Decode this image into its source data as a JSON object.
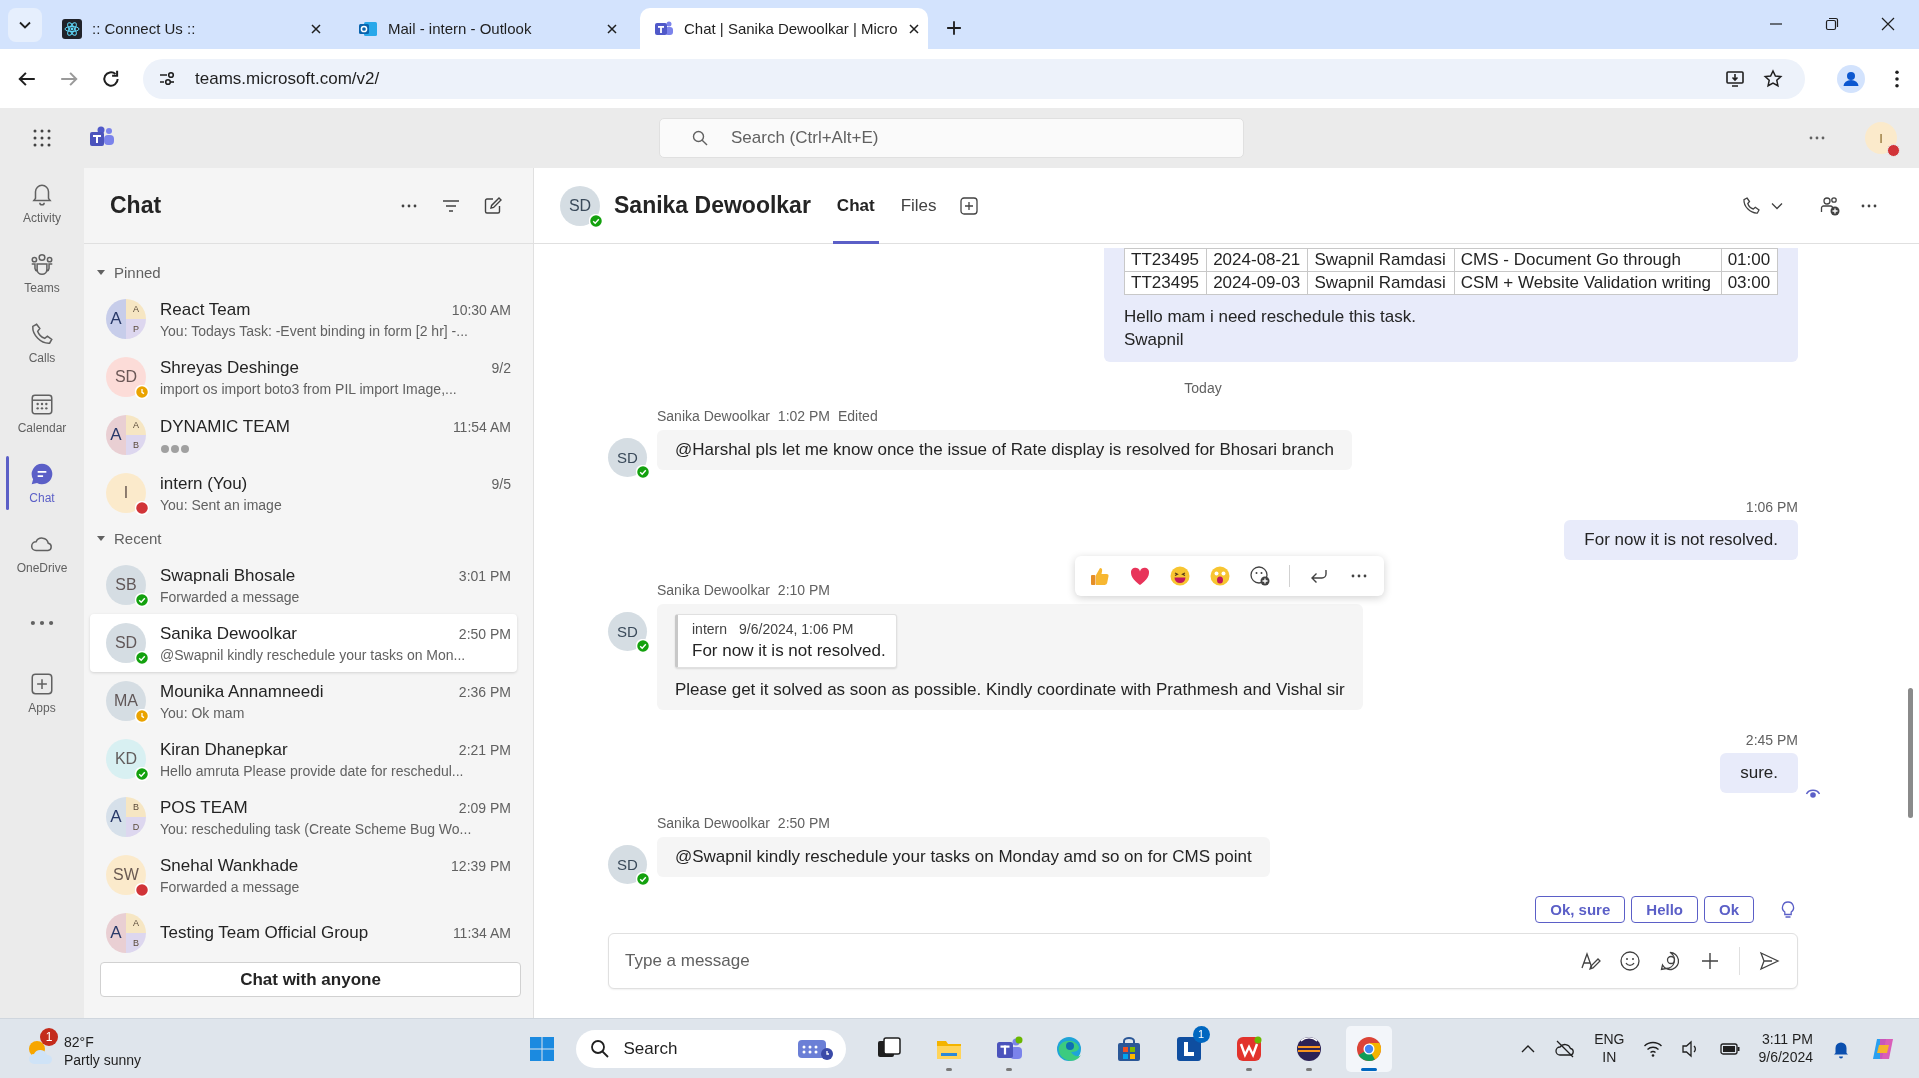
{
  "browser": {
    "tabs": [
      {
        "title": ":: Connect Us ::",
        "kind": "atom",
        "selected": false
      },
      {
        "title": "Mail - intern - Outlook",
        "kind": "mail",
        "selected": false
      },
      {
        "title": "Chat | Sanika Dewoolkar | Micro",
        "kind": "teams",
        "selected": true
      }
    ],
    "url": "teams.microsoft.com/v2/"
  },
  "teams_bar": {
    "search_placeholder": "Search (Ctrl+Alt+E)",
    "avatar": "I"
  },
  "rail": [
    {
      "label": "Activity",
      "kind": "bell",
      "selected": false
    },
    {
      "label": "Teams",
      "kind": "people",
      "selected": false
    },
    {
      "label": "Calls",
      "kind": "phone",
      "selected": false
    },
    {
      "label": "Calendar",
      "kind": "calendar",
      "selected": false
    },
    {
      "label": "Chat",
      "kind": "chat",
      "selected": true
    },
    {
      "label": "OneDrive",
      "kind": "cloud",
      "selected": false
    },
    {
      "kind": "more",
      "selected": false
    },
    {
      "label": "Apps",
      "kind": "apps",
      "selected": false
    }
  ],
  "chat_list": {
    "title": "Chat",
    "sections": [
      {
        "label": "Pinned",
        "expanded": true,
        "items": [
          {
            "name": "React Team",
            "time": "10:30 AM",
            "preview": "You: Todays Task: -Event binding in form [2 hr] -...",
            "group": [
              "A",
              "A",
              "P"
            ],
            "color": "#c7cdea",
            "selected": false
          },
          {
            "name": "Shreyas Deshinge",
            "time": "9/2",
            "preview": "import os import boto3 from PIL import Image,...",
            "initials": "SD",
            "color": "#fcdcd8",
            "presence": {
              "kind": "away",
              "color": "#eaa300"
            },
            "selected": false
          },
          {
            "name": "DYNAMIC TEAM",
            "time": "11:54 AM",
            "typing": true,
            "group": [
              "A",
              "A",
              "B"
            ],
            "color": "#e9cfd3",
            "selected": false
          },
          {
            "name": "intern (You)",
            "time": "9/5",
            "preview": "You: Sent an image",
            "initials": "I",
            "color": "#fbeacb",
            "presence": {
              "kind": "busy",
              "color": "#d13438"
            },
            "selected": false
          }
        ]
      },
      {
        "label": "Recent",
        "expanded": true,
        "items": [
          {
            "name": "Swapnali Bhosale",
            "time": "3:01 PM",
            "preview": "Forwarded a message",
            "initials": "SB",
            "color": "#d5dde3",
            "presence": {
              "kind": "available",
              "color": "#13a10e"
            },
            "selected": false
          },
          {
            "name": "Sanika Dewoolkar",
            "time": "2:50 PM",
            "preview": "@Swapnil kindly reschedule your tasks on Mon...",
            "initials": "SD",
            "color": "#d5dde3",
            "presence": {
              "kind": "available",
              "color": "#13a10e"
            },
            "selected": true
          },
          {
            "name": "Mounika Annamneedi",
            "time": "2:36 PM",
            "preview": "You: Ok mam",
            "initials": "MA",
            "color": "#d5dde3",
            "presence": {
              "kind": "away",
              "color": "#eaa300"
            },
            "selected": false
          },
          {
            "name": "Kiran Dhanepkar",
            "time": "2:21 PM",
            "preview": "Hello amruta Please provide date for reschedul...",
            "initials": "KD",
            "color": "#d8f0f2",
            "presence": {
              "kind": "available",
              "color": "#13a10e"
            },
            "selected": false
          },
          {
            "name": "POS TEAM",
            "time": "2:09 PM",
            "preview": "You: rescheduling task (Create Scheme Bug Wo...",
            "group": [
              "A",
              "B",
              "D"
            ],
            "color": "#d6e0ea",
            "selected": false
          },
          {
            "name": "Snehal Wankhade",
            "time": "12:39 PM",
            "preview": "Forwarded a message",
            "initials": "SW",
            "color": "#fbeacb",
            "presence": {
              "kind": "busy",
              "color": "#d13438"
            },
            "selected": false
          },
          {
            "name": "Testing Team Official Group",
            "time": "11:34 AM",
            "group": [
              "A",
              "A",
              "B"
            ],
            "color": "#e9cfd3",
            "selected": false
          }
        ]
      }
    ],
    "new_chat_button": "Chat with anyone"
  },
  "conversation": {
    "name": "Sanika Dewoolkar",
    "initials": "SD",
    "presence": {
      "kind": "available",
      "color": "#13a10e"
    },
    "tabs": [
      {
        "label": "Chat",
        "selected": true
      },
      {
        "label": "Files",
        "selected": false
      }
    ],
    "messages": [
      {
        "kind": "outgoing_table",
        "table": [
          [
            "TT23495",
            "2024-08-21",
            "Swapnil Ramdasi",
            "CMS - Document Go through",
            "01:00"
          ],
          [
            "TT23495",
            "2024-09-03",
            "Swapnil Ramdasi",
            "CSM + Website Validation writing",
            "03:00"
          ]
        ],
        "lines": [
          "Hello mam i need reschedule this task.",
          "Swapnil"
        ]
      },
      {
        "kind": "divider",
        "text": "Today"
      },
      {
        "kind": "incoming",
        "sender": "Sanika Dewoolkar",
        "time": "1:02 PM",
        "edited": "Edited",
        "initials": "SD",
        "presence": {
          "kind": "available",
          "color": "#13a10e"
        },
        "text": "@Harshal pls let me know once the issue of Rate display is resolved for Bhosari branch"
      },
      {
        "kind": "outgoing",
        "time": "1:06 PM",
        "text": "For now it is not resolved.",
        "seen": false
      },
      {
        "kind": "incoming",
        "sender": "Sanika Dewoolkar",
        "time": "2:10 PM",
        "initials": "SD",
        "presence": {
          "kind": "available",
          "color": "#13a10e"
        },
        "quote": {
          "author": "intern",
          "time": "9/6/2024, 1:06 PM",
          "text": "For now it is not resolved."
        },
        "text": "Please get it solved as soon as possible. Kindly coordinate with Prathmesh and Vishal sir",
        "reactions_bar": true
      },
      {
        "kind": "outgoing",
        "time": "2:45 PM",
        "text": "sure.",
        "seen": true
      },
      {
        "kind": "incoming",
        "sender": "Sanika Dewoolkar",
        "time": "2:50 PM",
        "initials": "SD",
        "presence": {
          "kind": "available",
          "color": "#13a10e"
        },
        "text": "@Swapnil kindly reschedule your tasks on Monday amd so on for CMS point"
      }
    ],
    "suggested_replies": [
      "Ok, sure",
      "Hello",
      "Ok"
    ],
    "compose_placeholder": "Type a message"
  },
  "taskbar": {
    "weather": {
      "temp": "82°F",
      "condition": "Partly sunny",
      "badge": "1"
    },
    "search": "Search",
    "apps": [
      {
        "kind": "taskview",
        "running": false,
        "active": false
      },
      {
        "kind": "folder",
        "running": true,
        "active": false
      },
      {
        "kind": "teams",
        "running": true,
        "active": false
      },
      {
        "kind": "edge",
        "running": false,
        "active": false
      },
      {
        "kind": "store",
        "running": false,
        "active": false
      },
      {
        "kind": "letter",
        "running": false,
        "active": false,
        "badge": "1"
      },
      {
        "kind": "office",
        "running": true,
        "active": false
      },
      {
        "kind": "eclipse",
        "running": true,
        "active": false
      },
      {
        "kind": "chrome",
        "running": true,
        "active": true
      }
    ],
    "language": [
      "ENG",
      "IN"
    ],
    "time": "3:11 PM",
    "date": "9/6/2024"
  }
}
